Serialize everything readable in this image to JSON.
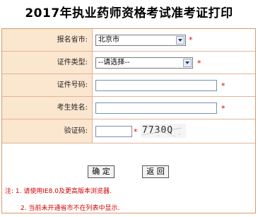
{
  "page": {
    "title": "2017年执业药师资格考试准考证打印"
  },
  "form": {
    "province": {
      "label": "报名省市:",
      "value": "北京市",
      "required_mark": "*"
    },
    "id_type": {
      "label": "证件类型:",
      "value": "--请选择--",
      "required_mark": "*"
    },
    "id_number": {
      "label": "证件号码:",
      "value": "",
      "required_mark": "*"
    },
    "name": {
      "label": "考生姓名:",
      "value": "",
      "required_mark": "*"
    },
    "captcha": {
      "label": "验证码:",
      "value": "",
      "required_mark": "*",
      "image_text": "7730Q"
    }
  },
  "actions": {
    "confirm_label": "确 定",
    "back_label": "返 回"
  },
  "notes": {
    "line1": "注: 1. 请使用IE8.0及更高版本浏览器.",
    "line2": "2. 当前未开通省市不在列表中显示."
  },
  "colors": {
    "label_bg": "#fbe6cf",
    "border": "#d79a6e",
    "required": "#e00000",
    "note": "#d00000"
  }
}
